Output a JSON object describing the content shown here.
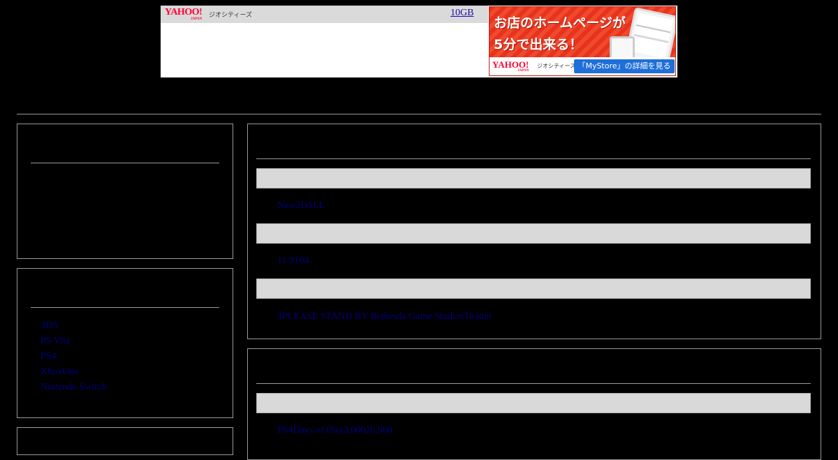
{
  "banner": {
    "brand_main": "YAHOO!",
    "brand_sub": "JAPAN",
    "service": "ジオシティーズ",
    "storage_link": "10GB",
    "ad": {
      "headline_line1": "お店のホームページが",
      "headline_line2": "5分で出来る！",
      "footer_brand": "YAHOO!",
      "footer_brand_sub": "JAPAN",
      "footer_service": "ジオシティーズ",
      "cta": "「MyStore」の詳細を見る",
      "accent": "#e8321e",
      "cta_color": "#1e6fd9"
    }
  },
  "sidebar": {
    "categories": [
      "3DS",
      "PS Vita",
      "PS4",
      "XboxOne",
      "Nintendo Switch"
    ]
  },
  "main": {
    "entries": [
      {
        "text": "New2DSLL"
      },
      {
        "text": "11:9104"
      },
      {
        "text": "3PLEASE STAND BY Bethesda Game StudiosTwitter"
      }
    ],
    "second_entries": [
      {
        "text": "PS4Days of Play3,00026,980"
      }
    ]
  },
  "colors": {
    "background": "#000000",
    "border": "#9a9a9a",
    "entry_bar": "#d9d9d9",
    "link": "#000080"
  }
}
